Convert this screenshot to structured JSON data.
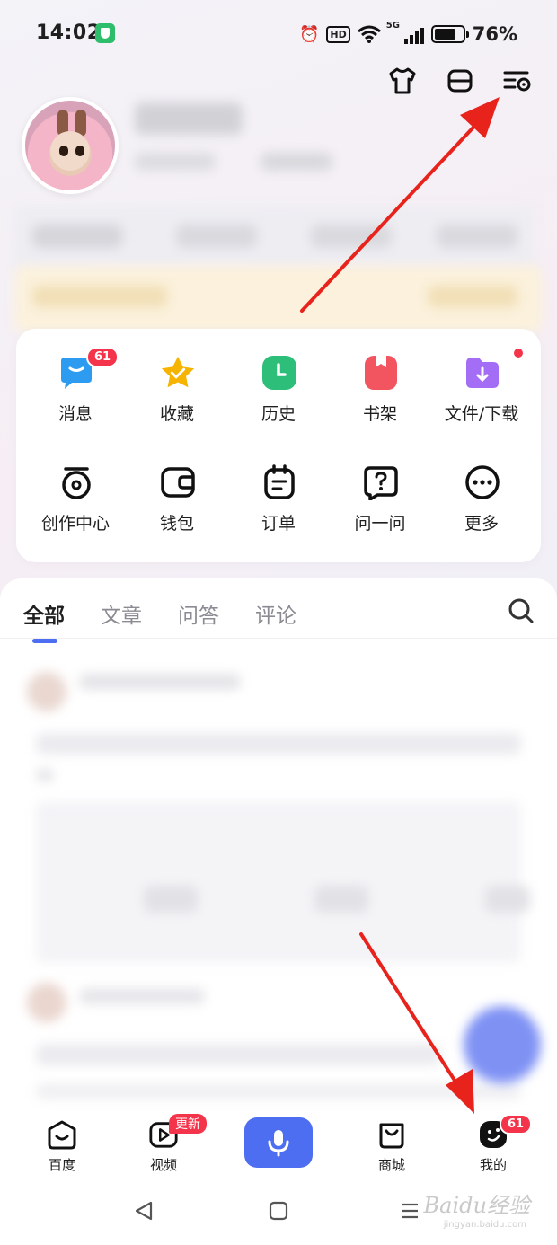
{
  "status_bar": {
    "time": "14:02",
    "hd": "HD",
    "network": "5G",
    "battery_pct": "76%",
    "battery_level": 0.76
  },
  "top_actions": [
    {
      "name": "skin-icon"
    },
    {
      "name": "menu-icon"
    },
    {
      "name": "settings-icon"
    }
  ],
  "grid": {
    "row1": [
      {
        "label": "消息",
        "icon": "message-icon",
        "color": "#2c9bf0",
        "badge": "61"
      },
      {
        "label": "收藏",
        "icon": "star-icon",
        "color": "#f6b400"
      },
      {
        "label": "历史",
        "icon": "clock-icon",
        "color": "#2dbf7a"
      },
      {
        "label": "书架",
        "icon": "bookmark-icon",
        "color": "#f2555f"
      },
      {
        "label": "文件/下载",
        "icon": "download-folder-icon",
        "color": "#a36ef5"
      }
    ],
    "row2": [
      {
        "label": "创作中心",
        "icon": "creator-icon"
      },
      {
        "label": "钱包",
        "icon": "wallet-icon"
      },
      {
        "label": "订单",
        "icon": "order-icon"
      },
      {
        "label": "问一问",
        "icon": "ask-icon"
      },
      {
        "label": "更多",
        "icon": "more-icon"
      }
    ]
  },
  "feed": {
    "tabs": [
      "全部",
      "文章",
      "问答",
      "评论"
    ],
    "active_tab": "全部"
  },
  "bottom_nav": {
    "items": [
      {
        "label": "百度",
        "icon": "baidu-home-icon"
      },
      {
        "label": "视频",
        "icon": "video-icon",
        "badge": "更新"
      },
      {
        "label": "",
        "icon": "mic-icon"
      },
      {
        "label": "商城",
        "icon": "shop-icon"
      },
      {
        "label": "我的",
        "icon": "profile-icon",
        "badge": "61"
      }
    ]
  },
  "watermark": {
    "text": "Baidu经验",
    "sub": "jingyan.baidu.com"
  },
  "colors": {
    "accent": "#4e6ef2",
    "badge": "#f3344a",
    "annotation_arrow": "#e8231c"
  }
}
